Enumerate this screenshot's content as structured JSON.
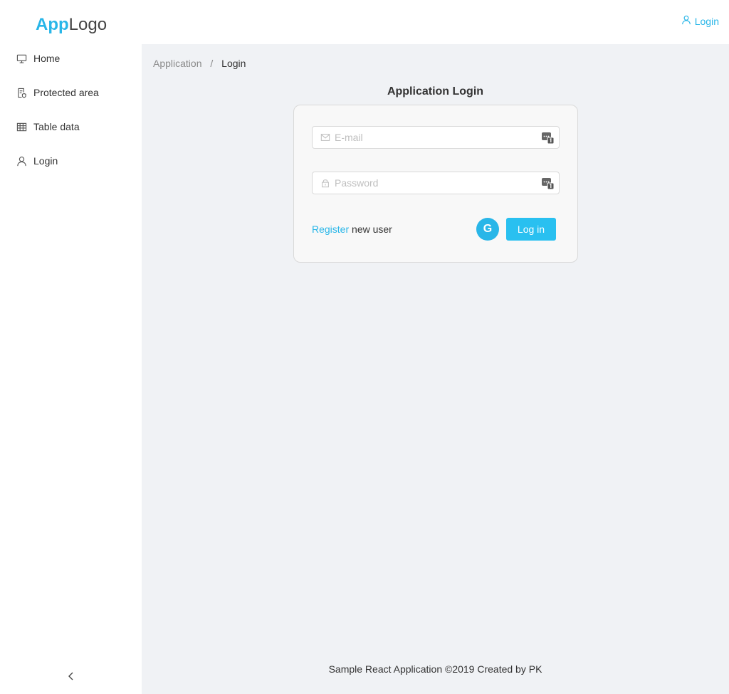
{
  "brand": {
    "logo_accent": "App",
    "logo_rest": "Logo",
    "accent_color": "#29b6e8"
  },
  "sidebar": {
    "items": [
      {
        "label": "Home",
        "icon": "desktop-icon"
      },
      {
        "label": "Protected area",
        "icon": "file-protect-icon"
      },
      {
        "label": "Table data",
        "icon": "table-icon"
      },
      {
        "label": "Login",
        "icon": "user-icon"
      }
    ],
    "collapse_icon": "chevron-left-icon"
  },
  "header": {
    "login_label": "Login",
    "login_icon": "user-icon"
  },
  "breadcrumb": {
    "items": [
      "Application",
      "Login"
    ],
    "separator": "/"
  },
  "login": {
    "title": "Application Login",
    "email_placeholder": "E-mail",
    "password_placeholder": "Password",
    "register_link": "Register",
    "register_suffix": " new user",
    "google_letter": "G",
    "submit_label": "Log in"
  },
  "footer": {
    "text": "Sample React Application ©2019 Created by PK"
  }
}
